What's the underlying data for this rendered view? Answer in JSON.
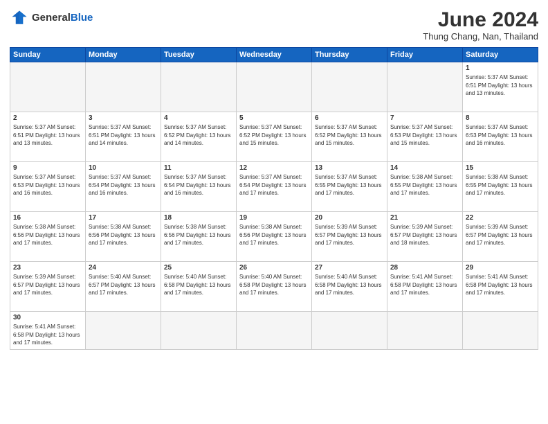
{
  "header": {
    "logo_general": "General",
    "logo_blue": "Blue",
    "month_title": "June 2024",
    "subtitle": "Thung Chang, Nan, Thailand"
  },
  "weekdays": [
    "Sunday",
    "Monday",
    "Tuesday",
    "Wednesday",
    "Thursday",
    "Friday",
    "Saturday"
  ],
  "weeks": [
    [
      {
        "day": "",
        "info": ""
      },
      {
        "day": "",
        "info": ""
      },
      {
        "day": "",
        "info": ""
      },
      {
        "day": "",
        "info": ""
      },
      {
        "day": "",
        "info": ""
      },
      {
        "day": "",
        "info": ""
      },
      {
        "day": "1",
        "info": "Sunrise: 5:37 AM\nSunset: 6:51 PM\nDaylight: 13 hours\nand 13 minutes."
      }
    ],
    [
      {
        "day": "2",
        "info": "Sunrise: 5:37 AM\nSunset: 6:51 PM\nDaylight: 13 hours\nand 13 minutes."
      },
      {
        "day": "3",
        "info": "Sunrise: 5:37 AM\nSunset: 6:51 PM\nDaylight: 13 hours\nand 14 minutes."
      },
      {
        "day": "4",
        "info": "Sunrise: 5:37 AM\nSunset: 6:52 PM\nDaylight: 13 hours\nand 14 minutes."
      },
      {
        "day": "5",
        "info": "Sunrise: 5:37 AM\nSunset: 6:52 PM\nDaylight: 13 hours\nand 15 minutes."
      },
      {
        "day": "6",
        "info": "Sunrise: 5:37 AM\nSunset: 6:52 PM\nDaylight: 13 hours\nand 15 minutes."
      },
      {
        "day": "7",
        "info": "Sunrise: 5:37 AM\nSunset: 6:53 PM\nDaylight: 13 hours\nand 15 minutes."
      },
      {
        "day": "8",
        "info": "Sunrise: 5:37 AM\nSunset: 6:53 PM\nDaylight: 13 hours\nand 16 minutes."
      }
    ],
    [
      {
        "day": "9",
        "info": "Sunrise: 5:37 AM\nSunset: 6:53 PM\nDaylight: 13 hours\nand 16 minutes."
      },
      {
        "day": "10",
        "info": "Sunrise: 5:37 AM\nSunset: 6:54 PM\nDaylight: 13 hours\nand 16 minutes."
      },
      {
        "day": "11",
        "info": "Sunrise: 5:37 AM\nSunset: 6:54 PM\nDaylight: 13 hours\nand 16 minutes."
      },
      {
        "day": "12",
        "info": "Sunrise: 5:37 AM\nSunset: 6:54 PM\nDaylight: 13 hours\nand 17 minutes."
      },
      {
        "day": "13",
        "info": "Sunrise: 5:37 AM\nSunset: 6:55 PM\nDaylight: 13 hours\nand 17 minutes."
      },
      {
        "day": "14",
        "info": "Sunrise: 5:38 AM\nSunset: 6:55 PM\nDaylight: 13 hours\nand 17 minutes."
      },
      {
        "day": "15",
        "info": "Sunrise: 5:38 AM\nSunset: 6:55 PM\nDaylight: 13 hours\nand 17 minutes."
      }
    ],
    [
      {
        "day": "16",
        "info": "Sunrise: 5:38 AM\nSunset: 6:56 PM\nDaylight: 13 hours\nand 17 minutes."
      },
      {
        "day": "17",
        "info": "Sunrise: 5:38 AM\nSunset: 6:56 PM\nDaylight: 13 hours\nand 17 minutes."
      },
      {
        "day": "18",
        "info": "Sunrise: 5:38 AM\nSunset: 6:56 PM\nDaylight: 13 hours\nand 17 minutes."
      },
      {
        "day": "19",
        "info": "Sunrise: 5:38 AM\nSunset: 6:56 PM\nDaylight: 13 hours\nand 17 minutes."
      },
      {
        "day": "20",
        "info": "Sunrise: 5:39 AM\nSunset: 6:57 PM\nDaylight: 13 hours\nand 17 minutes."
      },
      {
        "day": "21",
        "info": "Sunrise: 5:39 AM\nSunset: 6:57 PM\nDaylight: 13 hours\nand 18 minutes."
      },
      {
        "day": "22",
        "info": "Sunrise: 5:39 AM\nSunset: 6:57 PM\nDaylight: 13 hours\nand 17 minutes."
      }
    ],
    [
      {
        "day": "23",
        "info": "Sunrise: 5:39 AM\nSunset: 6:57 PM\nDaylight: 13 hours\nand 17 minutes."
      },
      {
        "day": "24",
        "info": "Sunrise: 5:40 AM\nSunset: 6:57 PM\nDaylight: 13 hours\nand 17 minutes."
      },
      {
        "day": "25",
        "info": "Sunrise: 5:40 AM\nSunset: 6:58 PM\nDaylight: 13 hours\nand 17 minutes."
      },
      {
        "day": "26",
        "info": "Sunrise: 5:40 AM\nSunset: 6:58 PM\nDaylight: 13 hours\nand 17 minutes."
      },
      {
        "day": "27",
        "info": "Sunrise: 5:40 AM\nSunset: 6:58 PM\nDaylight: 13 hours\nand 17 minutes."
      },
      {
        "day": "28",
        "info": "Sunrise: 5:41 AM\nSunset: 6:58 PM\nDaylight: 13 hours\nand 17 minutes."
      },
      {
        "day": "29",
        "info": "Sunrise: 5:41 AM\nSunset: 6:58 PM\nDaylight: 13 hours\nand 17 minutes."
      }
    ],
    [
      {
        "day": "30",
        "info": "Sunrise: 5:41 AM\nSunset: 6:58 PM\nDaylight: 13 hours\nand 17 minutes."
      },
      {
        "day": "",
        "info": ""
      },
      {
        "day": "",
        "info": ""
      },
      {
        "day": "",
        "info": ""
      },
      {
        "day": "",
        "info": ""
      },
      {
        "day": "",
        "info": ""
      },
      {
        "day": "",
        "info": ""
      }
    ]
  ]
}
